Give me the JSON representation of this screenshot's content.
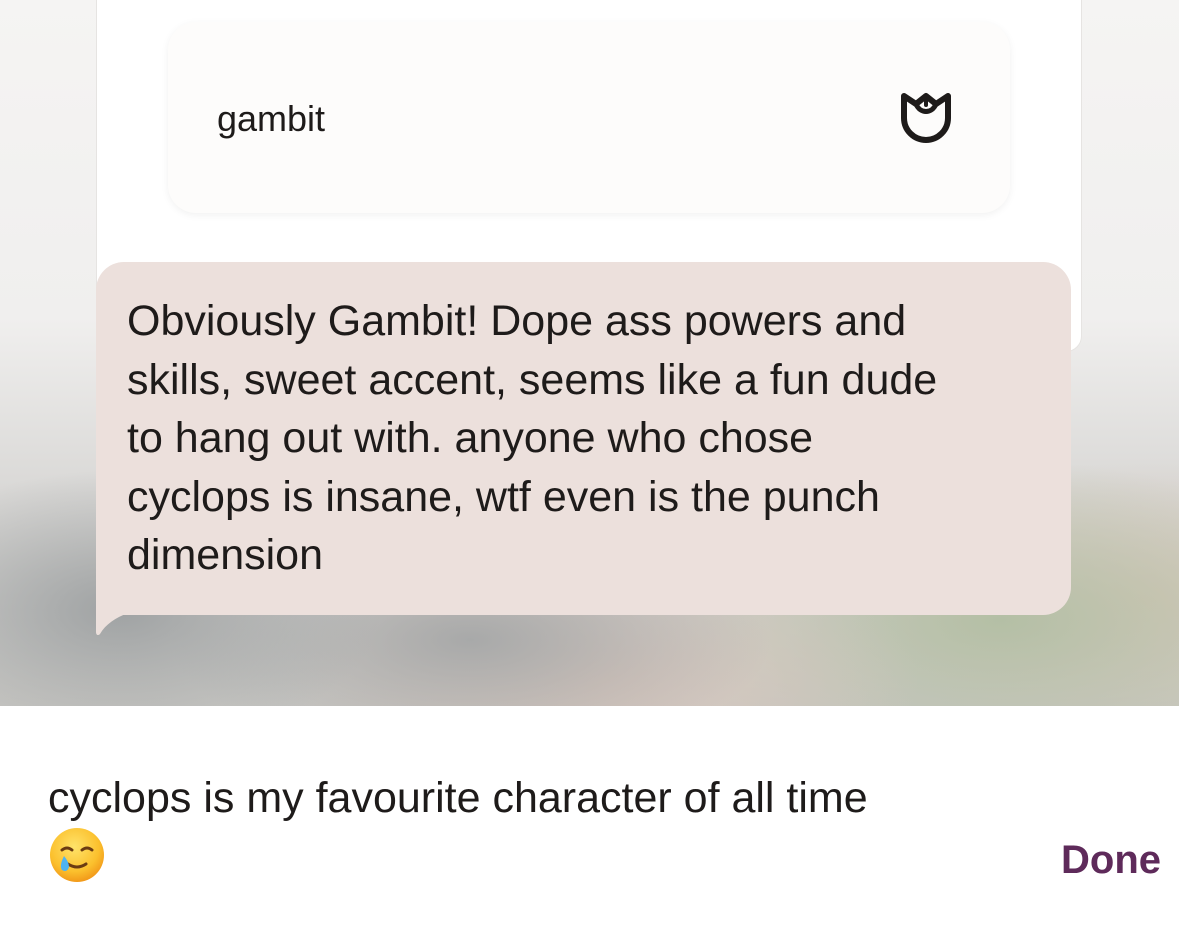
{
  "prompt_answer": {
    "label": "gambit",
    "icon": "rose-icon"
  },
  "comment": {
    "text": "Obviously Gambit! Dope ass powers and\nskills, sweet accent, seems like a fun dude\nto hang out with. anyone who chose\ncyclops is insane, wtf even is the punch\ndimension"
  },
  "reply_input": {
    "value": "cyclops is my favourite character of all time",
    "emoji": "smiling-face-with-tear-icon"
  },
  "done_button": {
    "label": "Done"
  },
  "colors": {
    "accent": "#5e2a5a",
    "bubble": "#ece0dc",
    "text": "#1e1b1a"
  }
}
